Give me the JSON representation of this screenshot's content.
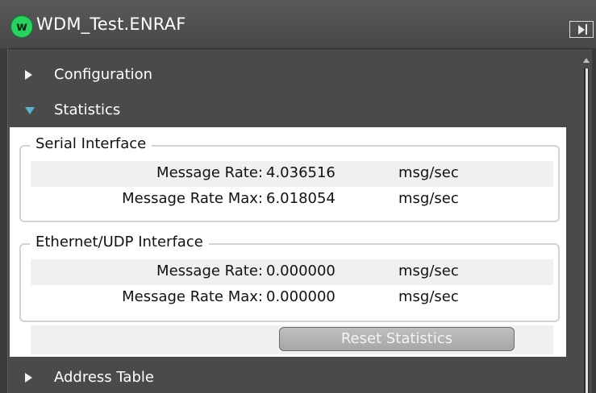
{
  "window": {
    "badge_letter": "w",
    "title": "WDM_Test.ENRAF",
    "badge_color": "#27d35f"
  },
  "tree": {
    "configuration": "Configuration",
    "statistics": "Statistics",
    "address_table": "Address Table"
  },
  "serial": {
    "legend": "Serial Interface",
    "rows": [
      {
        "label": "Message Rate:",
        "value": "4.036516",
        "unit": "msg/sec"
      },
      {
        "label": "Message Rate Max:",
        "value": "6.018054",
        "unit": "msg/sec"
      }
    ]
  },
  "ethernet": {
    "legend": "Ethernet/UDP Interface",
    "rows": [
      {
        "label": "Message Rate:",
        "value": "0.000000",
        "unit": "msg/sec"
      },
      {
        "label": "Message Rate Max:",
        "value": "0.000000",
        "unit": "msg/sec"
      }
    ]
  },
  "actions": {
    "reset_label": "Reset Statistics"
  },
  "colors": {
    "background": "#4a4a4a",
    "expanded_arrow": "#55b6cc",
    "panel": "#ffffff"
  }
}
